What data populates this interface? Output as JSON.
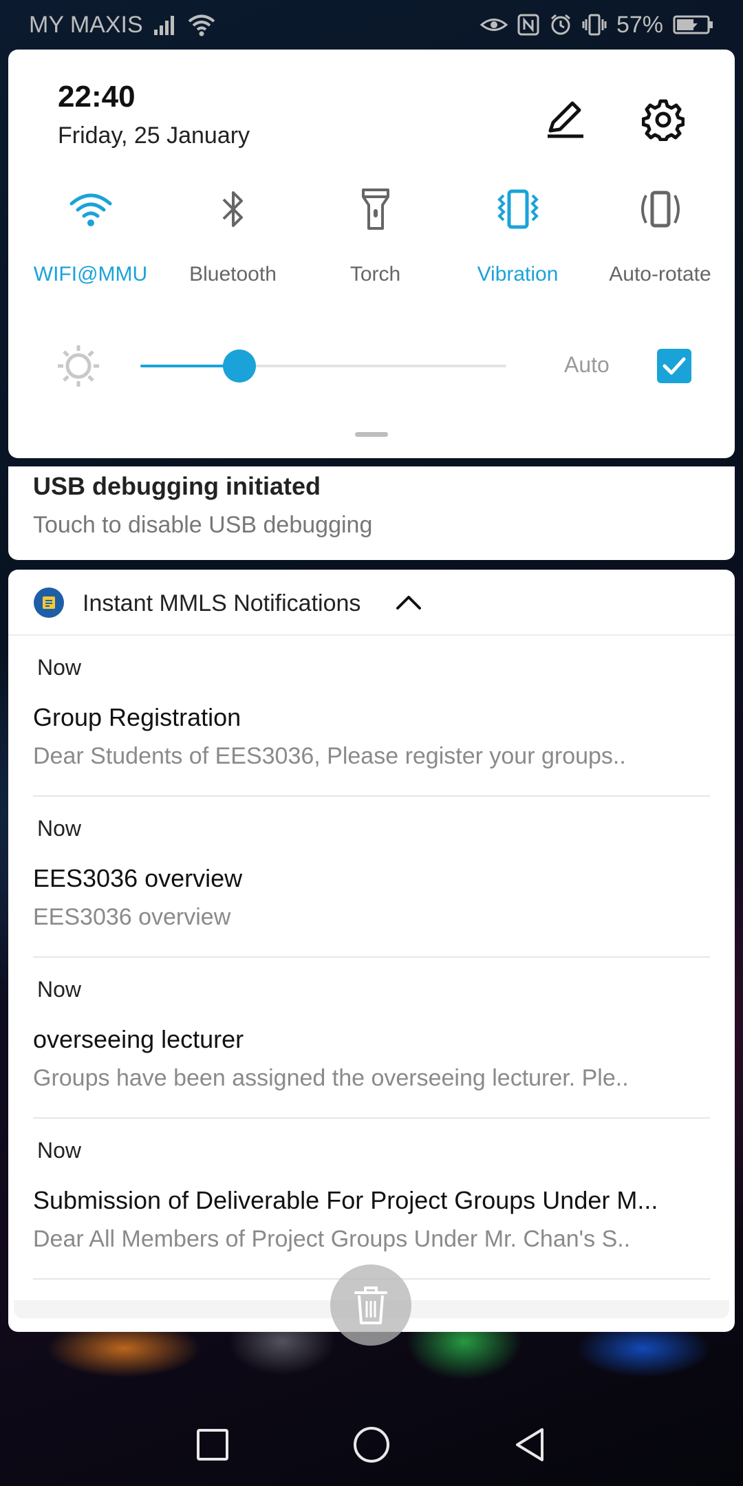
{
  "status_bar": {
    "carrier": "MY MAXIS",
    "battery_percent": "57%",
    "icons": [
      "signal-icon",
      "wifi-icon",
      "eye-icon",
      "nfc-icon",
      "alarm-icon",
      "vibrate-icon",
      "battery-charging-icon"
    ]
  },
  "quick_settings": {
    "time": "22:40",
    "date": "Friday, 25 January",
    "tiles": [
      {
        "label": "WIFI@MMU",
        "icon": "wifi-icon",
        "active": true
      },
      {
        "label": "Bluetooth",
        "icon": "bluetooth-icon",
        "active": false
      },
      {
        "label": "Torch",
        "icon": "torch-icon",
        "active": false
      },
      {
        "label": "Vibration",
        "icon": "vibration-icon",
        "active": true
      },
      {
        "label": "Auto-rotate",
        "icon": "auto-rotate-icon",
        "active": false
      }
    ],
    "brightness": {
      "level": 0.27,
      "auto_label": "Auto",
      "auto_checked": true
    },
    "accent_color": "#1aa3d8"
  },
  "usb_notification": {
    "title": "USB debugging initiated",
    "subtitle": "Touch to disable USB debugging"
  },
  "notification_group": {
    "app_name": "Instant MMLS Notifications",
    "items": [
      {
        "time": "Now",
        "title": "Group Registration",
        "body": "Dear Students of EES3036,  Please register your groups.."
      },
      {
        "time": "Now",
        "title": "EES3036 overview",
        "body": "EES3036 overview"
      },
      {
        "time": "Now",
        "title": "overseeing lecturer",
        "body": "Groups have been assigned the overseeing lecturer. Ple.."
      },
      {
        "time": "Now",
        "title": "Submission of Deliverable For Project Groups Under M...",
        "body": "Dear All Members of Project Groups Under Mr. Chan's S.."
      }
    ]
  },
  "nav_bar": {
    "buttons": [
      "recents-icon",
      "home-icon",
      "back-icon"
    ]
  }
}
